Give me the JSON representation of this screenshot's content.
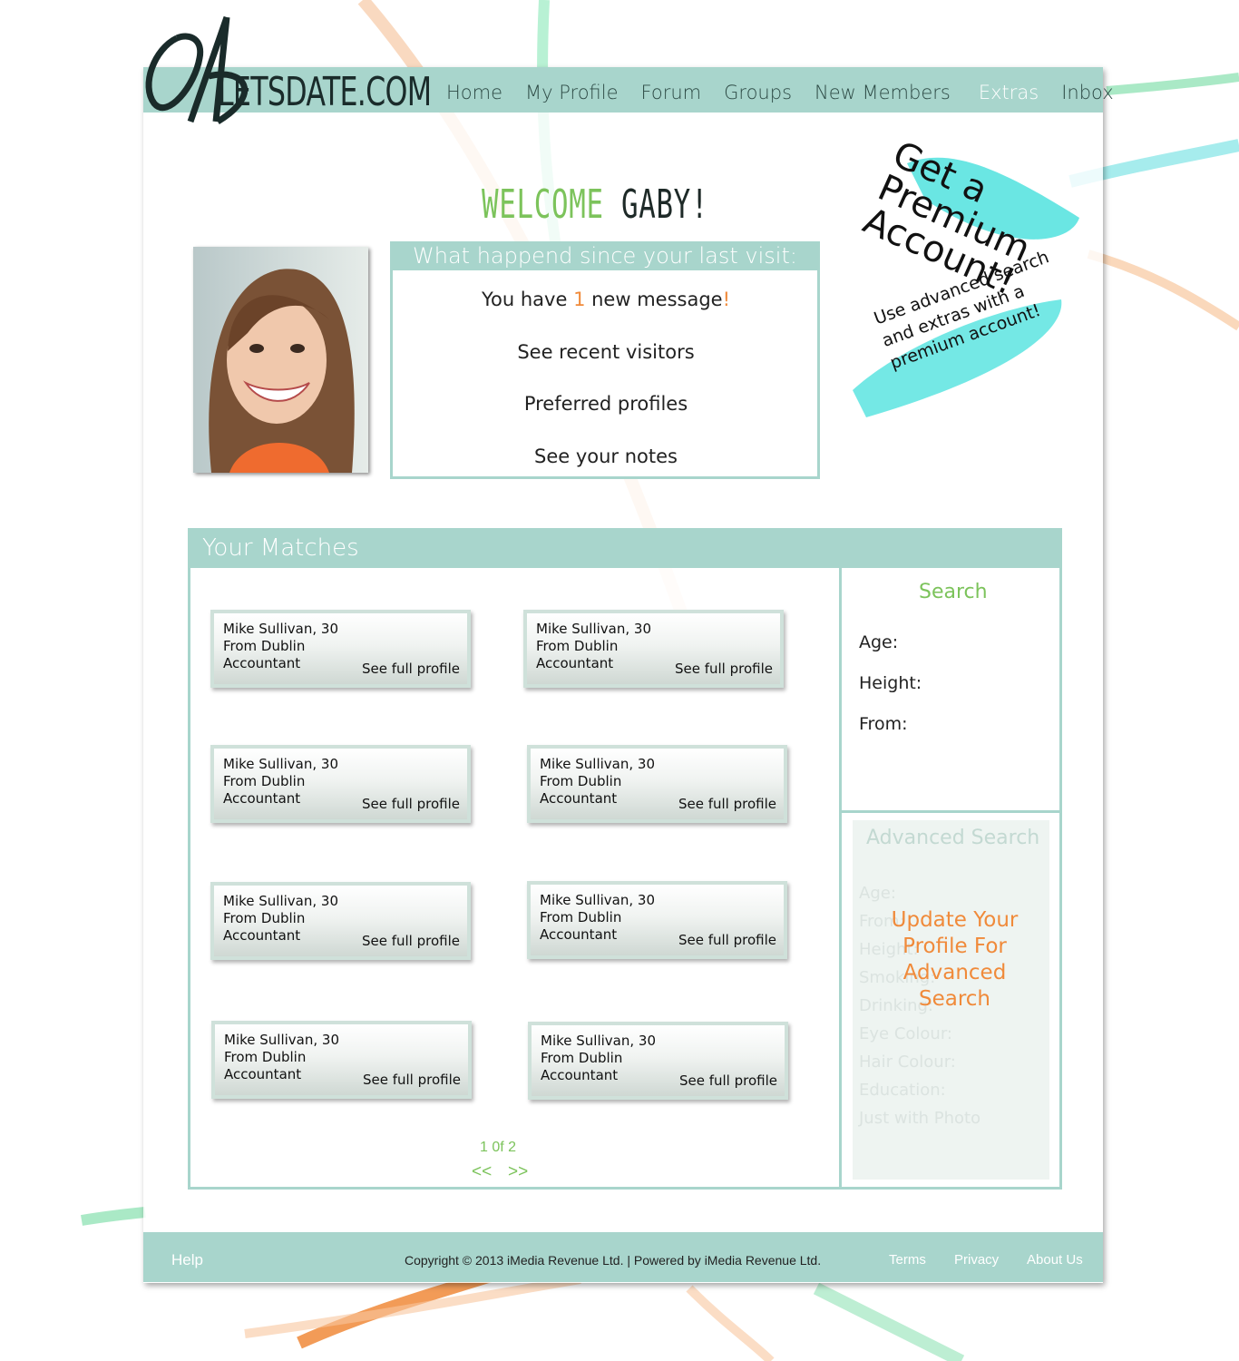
{
  "site": {
    "logo": "LETSDATE.COM"
  },
  "nav": {
    "items": [
      {
        "label": "Home",
        "active": false
      },
      {
        "label": "My Profile",
        "active": false
      },
      {
        "label": "Forum",
        "active": false
      },
      {
        "label": "Groups",
        "active": false
      },
      {
        "label": "New Members",
        "active": false
      },
      {
        "label": "Extras",
        "active": true
      },
      {
        "label": "Inbox",
        "active": false
      }
    ]
  },
  "welcome": {
    "greeting": "WELCOME",
    "name": "GABY!"
  },
  "since_last_visit": {
    "title": "What happend since your last visit:",
    "message_prefix": "You have",
    "message_count": "1",
    "message_suffix": "new message",
    "message_bang": "!",
    "links": [
      "See recent visitors",
      "Preferred profiles",
      "See your notes"
    ]
  },
  "premium": {
    "title": "Get a Premium Account!",
    "subtitle": "Use advanced search and extras with a premium account!"
  },
  "matches": {
    "title": "Your Matches",
    "cards": [
      {
        "name": "Mike Sullivan, 30",
        "from": "From Dublin",
        "job": "Accountant",
        "link": "See full profile"
      },
      {
        "name": "Mike Sullivan, 30",
        "from": "From Dublin",
        "job": "Accountant",
        "link": "See full profile"
      },
      {
        "name": "Mike Sullivan, 30",
        "from": "From Dublin",
        "job": "Accountant",
        "link": "See full profile"
      },
      {
        "name": "Mike Sullivan, 30",
        "from": "From Dublin",
        "job": "Accountant",
        "link": "See full profile"
      },
      {
        "name": "Mike Sullivan, 30",
        "from": "From Dublin",
        "job": "Accountant",
        "link": "See full profile"
      },
      {
        "name": "Mike Sullivan, 30",
        "from": "From Dublin",
        "job": "Accountant",
        "link": "See full profile"
      },
      {
        "name": "Mike Sullivan, 30",
        "from": "From Dublin",
        "job": "Accountant",
        "link": "See full profile"
      },
      {
        "name": "Mike Sullivan, 30",
        "from": "From Dublin",
        "job": "Accountant",
        "link": "See full profile"
      }
    ],
    "pager": {
      "text": "1 0f 2",
      "prev": "<<",
      "next": ">>"
    }
  },
  "search": {
    "title": "Search",
    "fields": [
      "Age:",
      "Height:",
      "From:"
    ]
  },
  "advanced_search": {
    "title": "Advanced Search",
    "fields": [
      "Age:",
      "From:",
      "Height:",
      "Smoking:",
      "Drinking:",
      "Eye Colour:",
      "Hair Colour:",
      "Education:",
      "Just with Photo"
    ],
    "upgrade": "Update Your Profile For Advanced Search"
  },
  "footer": {
    "help": "Help",
    "copyright": "Copyright © 2013 iMedia Revenue Ltd.  | Powered by iMedia Revenue Ltd.",
    "links": [
      "Terms",
      "Privacy",
      "About Us"
    ]
  },
  "colors": {
    "accent": "#a8d5cc",
    "green": "#7cc35b",
    "orange": "#f08a3a"
  }
}
